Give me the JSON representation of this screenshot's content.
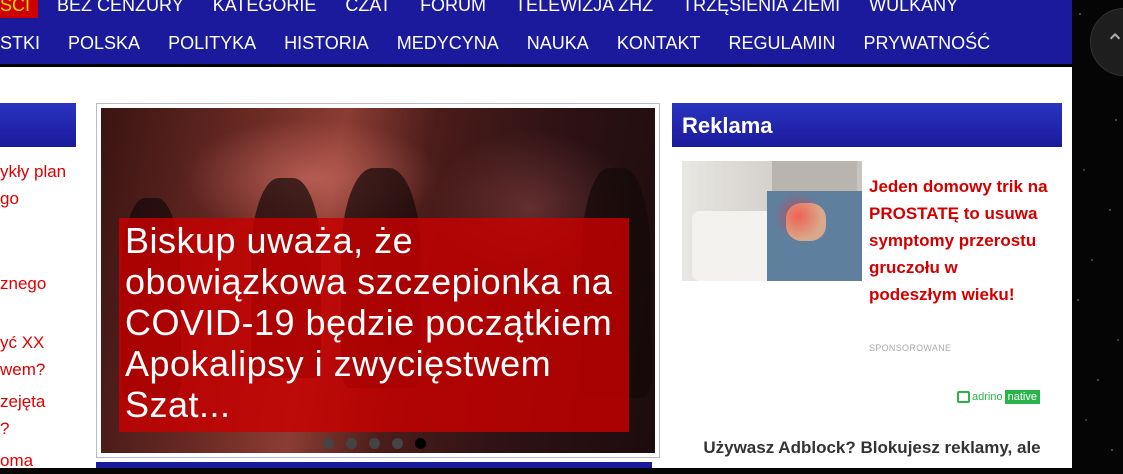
{
  "nav": {
    "row1": [
      "ŚCI",
      "BEZ CENZURY",
      "KATEGORIE",
      "CZAT",
      "FORUM",
      "TELEWIZJA ZHZ",
      "TRZĘSIENIA ZIEMI",
      "WULKANY"
    ],
    "row2": [
      "STKI",
      "POLSKA",
      "POLITYKA",
      "HISTORIA",
      "MEDYCYNA",
      "NAUKA",
      "KONTAKT",
      "REGULAMIN",
      "PRYWATNOŚĆ"
    ]
  },
  "left": {
    "links": [
      "ykły plan",
      "go",
      "znego",
      "yć XX",
      "wem?",
      "zejęta",
      "?",
      "oma"
    ]
  },
  "slider": {
    "caption": "Biskup uważa, że obowiązkowa szczepionka na COVID-19 będzie początkiem Apokalipsy i zwycięstwem Szat...",
    "dots": 5,
    "active_dot": 5
  },
  "ad": {
    "heading": "Reklama",
    "title": "Jeden domowy trik na PROSTATĘ to usuwa symptomy przerostu gruczołu w podeszłym wieku!",
    "sponsored": "SPONSOROWANE",
    "network_brand": "adrino",
    "network_tag": "native"
  },
  "adblock": {
    "text": "Używasz Adblock? Blokujesz reklamy, ale"
  },
  "colors": {
    "nav_bg": "#1b1a9c",
    "link_red": "#e00000",
    "caption_red": "#c80000"
  }
}
